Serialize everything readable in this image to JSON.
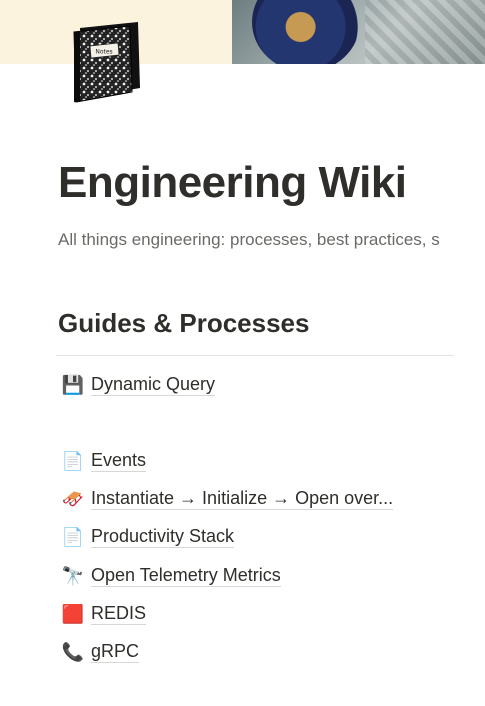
{
  "page": {
    "title": "Engineering Wiki",
    "subtitle": "All things engineering: processes, best practices, s",
    "page_icon": "notebook-icon",
    "page_icon_text": "Notes"
  },
  "sections": [
    {
      "heading": "Guides & Processes",
      "links": [
        {
          "icon": "floppy-disk-icon",
          "glyph": "💾",
          "label": "Dynamic Query"
        },
        {
          "icon": "document-icon",
          "glyph": "📄",
          "label": "Events"
        },
        {
          "icon": "sled-icon",
          "glyph": "🛷",
          "label": "Instantiate → Initialize → Open over..."
        },
        {
          "icon": "document-icon",
          "glyph": "📄",
          "label": "Productivity Stack"
        },
        {
          "icon": "telescope-icon",
          "glyph": "🔭",
          "label": "Open Telemetry Metrics"
        },
        {
          "icon": "red-square-icon",
          "glyph": "🟥",
          "label": "REDIS"
        },
        {
          "icon": "telephone-icon",
          "glyph": "📞",
          "label": "gRPC"
        }
      ]
    }
  ]
}
